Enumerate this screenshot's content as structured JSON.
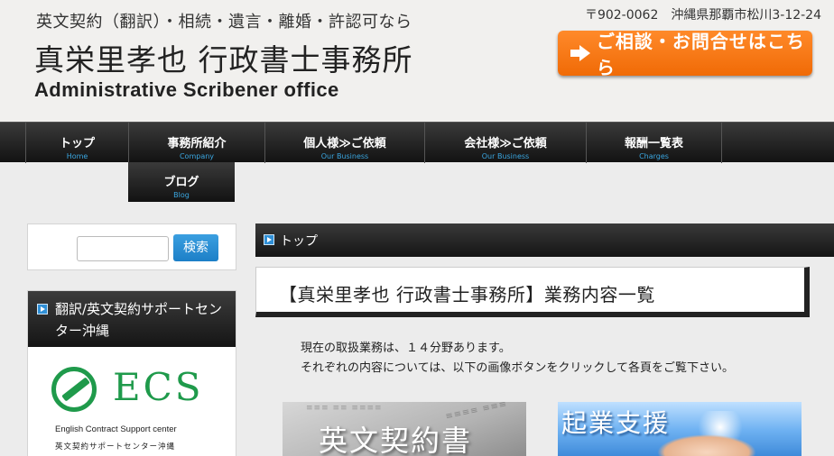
{
  "header": {
    "tagline": "英文契約（翻訳）・相続・遺言・離婚・許認可なら",
    "office_name": "真栄里孝也 行政書士事務所",
    "office_name_en": "Administrative Scribener office",
    "address": "〒902-0062　沖縄県那覇市松川3-12-24",
    "contact_button": "ご相談・お問合せはこちら"
  },
  "nav": {
    "items": [
      {
        "label": "トップ",
        "sub": "Home"
      },
      {
        "label": "事務所紹介",
        "sub": "Company"
      },
      {
        "label": "個人様≫ご依頼",
        "sub": "Our Business"
      },
      {
        "label": "会社様≫ご依頼",
        "sub": "Our Business"
      },
      {
        "label": "報酬一覧表",
        "sub": "Charges"
      },
      {
        "label": "ブログ",
        "sub": "Blog"
      }
    ]
  },
  "sidebar": {
    "search_button": "検索",
    "search_placeholder": "",
    "widget_title": "翻訳/英文契約サポートセンター沖縄",
    "ecs": {
      "logo_text": "ECS",
      "subtitle": "English Contract Support center",
      "subtitle_jp": "英文契約サポートセンター沖縄"
    }
  },
  "main": {
    "breadcrumb": "トップ",
    "heading": "【真栄里孝也 行政書士事務所】業務内容一覧",
    "intro_line1": "現在の取扱業務は、１４分野あります。",
    "intro_line2": "それぞれの内容については、以下の画像ボタンをクリックして各頁をご覧下さい。",
    "services": [
      {
        "title": "英文契約書"
      },
      {
        "title": "起業支援"
      }
    ]
  },
  "colors": {
    "accent_orange": "#f06a06",
    "nav_dark": "#121212",
    "nav_sub_blue": "#3aa6e0",
    "ecs_green": "#1f9a4b",
    "search_blue": "#1c7fc7"
  }
}
